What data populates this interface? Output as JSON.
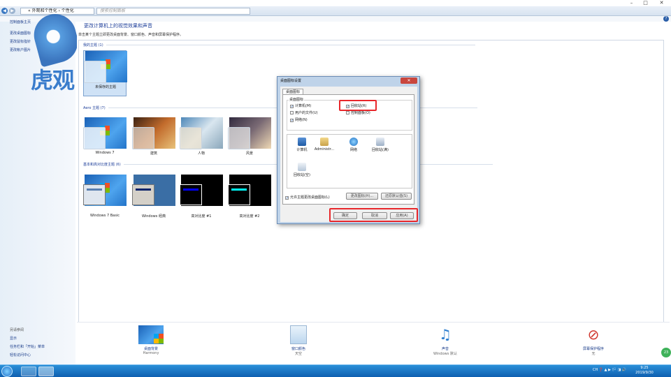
{
  "address": {
    "path": "« 外观和个性化 › 个性化",
    "search_placeholder": "搜索控制面板"
  },
  "window_controls": {
    "minimize": "–",
    "maximize": "□",
    "close": "✕"
  },
  "help": "?",
  "sidebar": {
    "items": [
      "控制面板主页",
      "更改桌面图标",
      "更改鼠标指针",
      "更改帐户图片"
    ],
    "see_also_title": "另请参阅",
    "see_also": [
      "显示",
      "任务栏和「开始」菜单",
      "轻松访问中心"
    ]
  },
  "watermark": "虎观",
  "main": {
    "title": "更改计算机上的视觉效果和声音",
    "subtitle": "单击某个主题立即更改桌面背景、窗口颜色、声音和屏幕保护程序。",
    "sections": {
      "mine": "我的主题 (1)",
      "aero": "Aero 主题 (7)",
      "basic": "基本和高对比度主题 (6)"
    },
    "my_themes": [
      "未保存的主题"
    ],
    "aero_themes": [
      "Windows 7",
      "建筑",
      "人物",
      "风景"
    ],
    "basic_themes": [
      "Windows 7 Basic",
      "Windows 经典",
      "高对比度 #1",
      "高对比度 #2"
    ]
  },
  "dialog": {
    "title": "桌面图标设置",
    "close": "✕",
    "tab": "桌面图标",
    "group_label": "桌面图标",
    "checkboxes": [
      {
        "label": "计算机(M)",
        "checked": true
      },
      {
        "label": "用户的文件(U)",
        "checked": false
      },
      {
        "label": "网络(N)",
        "checked": true
      },
      {
        "label": "回收站(R)",
        "checked": true
      },
      {
        "label": "控制面板(O)",
        "checked": false
      }
    ],
    "icons": [
      "计算机",
      "Administr...",
      "网络",
      "回收站(满)",
      "回收站(空)"
    ],
    "change_icon": "更改图标(H)...",
    "restore_default": "还原默认值(S)",
    "allow_themes": "允许主题更改桌面图标(L)",
    "allow_themes_checked": true,
    "ok": "确定",
    "cancel": "取消",
    "apply": "应用(A)"
  },
  "bottom": [
    {
      "title": "桌面背景",
      "value": "Harmony"
    },
    {
      "title": "窗口颜色",
      "value": "天空"
    },
    {
      "title": "声音",
      "value": "Windows 默认"
    },
    {
      "title": "屏幕保护程序",
      "value": "无"
    }
  ],
  "taskbar": {
    "tray": "CH ❓ ▲ ▶ 🏳 ◨ 🔊",
    "time": "9:25",
    "date": "2019/9/30",
    "badge": "23"
  },
  "colors": {
    "accent": "#1e3f9a",
    "highlight": "#e8272b",
    "taskbar": "#0f5fb0"
  }
}
